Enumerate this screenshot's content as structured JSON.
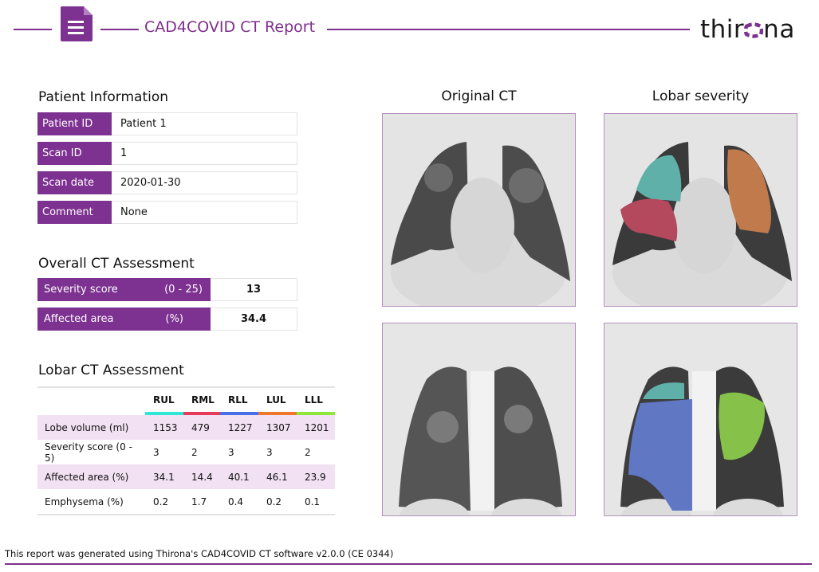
{
  "header": {
    "title": "CAD4COVID CT Report",
    "icon": "document-icon",
    "logo_text_before": "thir",
    "logo_text_after": "na",
    "accent_color": "#7d2f8b"
  },
  "patient_info": {
    "heading": "Patient Information",
    "rows": [
      {
        "label": "Patient ID",
        "value": "Patient 1"
      },
      {
        "label": "Scan ID",
        "value": "1"
      },
      {
        "label": "Scan date",
        "value": "2020-01-30"
      },
      {
        "label": "Comment",
        "value": "None"
      }
    ]
  },
  "overall": {
    "heading": "Overall CT Assessment",
    "rows": [
      {
        "label": "Severity score",
        "unit": "(0 - 25)",
        "value": "13"
      },
      {
        "label": "Affected area",
        "unit": "(%)",
        "value": "34.4"
      }
    ]
  },
  "lobar": {
    "heading": "Lobar CT Assessment",
    "columns": [
      {
        "name": "RUL",
        "color": "#2ee8d6"
      },
      {
        "name": "RML",
        "color": "#e83a5a"
      },
      {
        "name": "RLL",
        "color": "#4a6ee8"
      },
      {
        "name": "LUL",
        "color": "#f0782e"
      },
      {
        "name": "LLL",
        "color": "#8ee83a"
      }
    ],
    "rows": [
      {
        "label": "Lobe volume  (ml)",
        "values": [
          "1153",
          "479",
          "1227",
          "1307",
          "1201"
        ]
      },
      {
        "label": "Severity score (0 - 5)",
        "values": [
          "3",
          "2",
          "3",
          "3",
          "2"
        ]
      },
      {
        "label": "Affected area  (%)",
        "values": [
          "34.1",
          "14.4",
          "40.1",
          "46.1",
          "23.9"
        ]
      },
      {
        "label": "Emphysema  (%)",
        "values": [
          "0.2",
          "1.7",
          "0.4",
          "0.2",
          "0.1"
        ]
      }
    ]
  },
  "images": {
    "original_title": "Original CT",
    "severity_title": "Lobar severity"
  },
  "footer": {
    "text": "This report was generated using Thirona's CAD4COVID CT software v2.0.0 (CE 0344)"
  }
}
